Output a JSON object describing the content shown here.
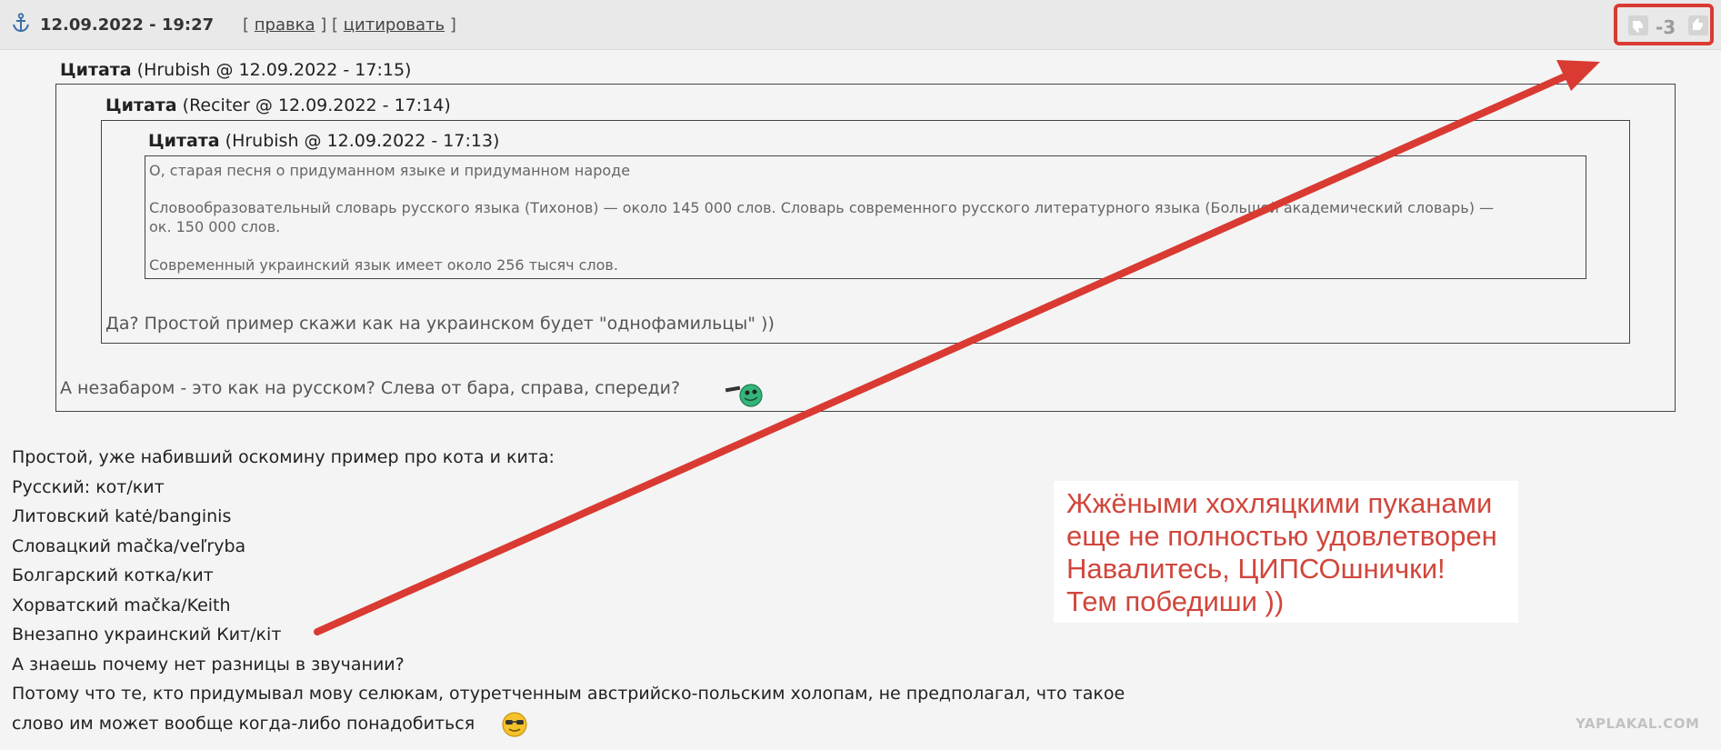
{
  "post": {
    "date": "12.09.2022 - 19:27",
    "actions": {
      "open": "[",
      "edit": "правка",
      "mid": "] [",
      "quote": "цитировать",
      "close": "]"
    },
    "rating": "-3"
  },
  "quotes": {
    "outer": {
      "label": "Цитата",
      "meta": "(Hrubish @ 12.09.2022 - 17:15)",
      "text": "А незабаром - это как на русском? Слева от бара, справа, спереди?"
    },
    "middle": {
      "label": "Цитата",
      "meta": "(Reciter @ 12.09.2022 - 17:14)",
      "text": "Да? Простой пример скажи как на украинском будет \"однофамильцы\" ))"
    },
    "inner": {
      "label": "Цитата",
      "meta": "(Hrubish @ 12.09.2022 - 17:13)",
      "lines": [
        "О, старая песня о придуманном языке и придуманном народе",
        "Словообразовательный словарь русского языка (Тихонов) — около 145 000 слов. Словарь современного русского литературного языка (Большой академический словарь) —",
        "ок. 150 000 слов.",
        "Современный украинский язык имеет около 256 тысяч слов."
      ]
    }
  },
  "body": {
    "lines": [
      "Простой, уже набивший оскомину пример про кота и кита:",
      "Русский: кот/кит",
      "Литовский katė/banginis",
      "Словацкий mačka/veľryba",
      "Болгарский котка/кит",
      "Хорватский mačka/Keith",
      "Внезапно украинский Кит/кіт",
      "А знаешь почему нет разницы в звучании?",
      "Потому что те, кто придумывал мову селюкам, отуретченным австрийско-польским холопам, не предполагал, что такое",
      "слово им может вообще когда-либо понадобиться"
    ]
  },
  "annotation": {
    "lines": [
      "Жжёными хохляцкими пуканами",
      "еще не полностью удовлетворен",
      "Навалитесь, ЦИПСОшнички!",
      "Тем победиши ))"
    ],
    "color": "#d0463c"
  },
  "watermark": "YAPLAKAL.COM",
  "icons": [
    "anchor-icon",
    "thumb-down-icon",
    "thumb-up-icon",
    "glasses-smiley-icon",
    "cool-smiley-icon"
  ]
}
